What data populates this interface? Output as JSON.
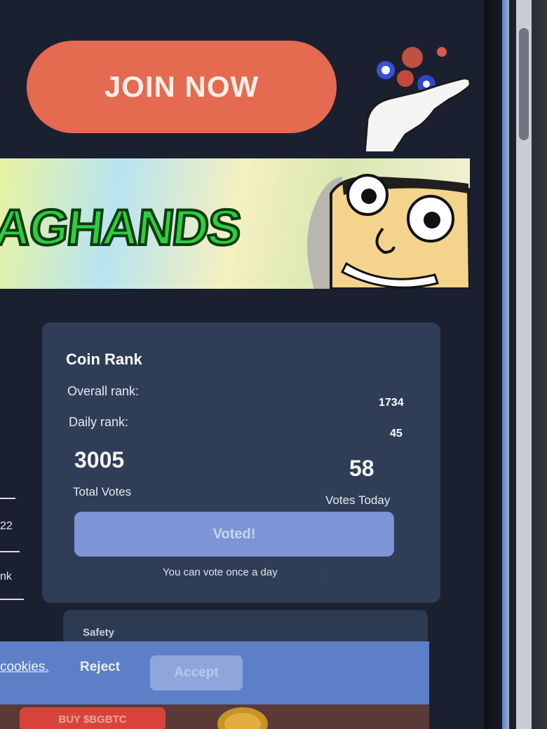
{
  "header": {
    "join_label": "JOIN NOW"
  },
  "banner": {
    "title": "AGHANDS"
  },
  "coin_rank": {
    "title": "Coin Rank",
    "overall_label": "Overall rank:",
    "overall_value": "1734",
    "daily_label": "Daily rank:",
    "daily_value": "45",
    "total_votes": "3005",
    "total_votes_label": "Total Votes",
    "votes_today": "58",
    "votes_today_label": "Votes Today",
    "vote_button_label": "Voted!",
    "vote_note": "You can vote once a day"
  },
  "left_fragments": {
    "date_fragment": "22",
    "rank_fragment": "nk"
  },
  "safety": {
    "title": "Safety"
  },
  "cookie_bar": {
    "cookies_link": "cookies.",
    "reject_label": "Reject",
    "accept_label": "Accept"
  },
  "bottom": {
    "buy_label": "BUY $BGBTC"
  },
  "colors": {
    "join_button": "#e46a50",
    "card_bg": "#2f3d56",
    "vote_button": "#7d95d6",
    "cookie_bar": "#5d7fc8",
    "banner_title": "#2ccf3e"
  }
}
